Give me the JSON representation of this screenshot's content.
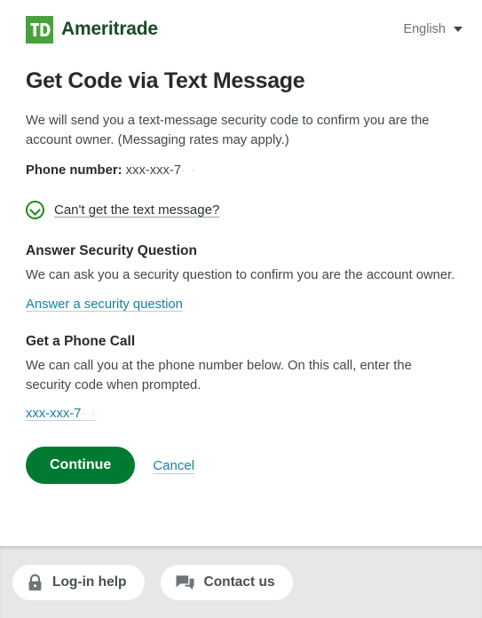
{
  "header": {
    "logo_mark": "td-logo",
    "brand_name": "Ameritrade",
    "language_label": "English",
    "language_caret": "chevron-down-icon"
  },
  "main": {
    "title": "Get Code via Text Message",
    "intro": "We will send you a text-message security code to confirm you are the account owner. (Messaging rates may apply.)",
    "phone_label": "Phone number:",
    "phone_value": "xxx-xxx-7",
    "phone_value_redacted": "· ·",
    "expander": {
      "icon": "circle-chevron-down-icon",
      "label": "Can't get the text message?"
    },
    "sections": [
      {
        "title": "Answer Security Question",
        "body": "We can ask you a security question to confirm you are the account owner.",
        "link": "Answer a security question"
      },
      {
        "title": "Get a Phone Call",
        "body": "We can call you at the phone number below. On this call, enter the security code when prompted.",
        "link": "xxx-xxx-7",
        "link_redacted": "· ·"
      }
    ],
    "continue_label": "Continue",
    "cancel_label": "Cancel"
  },
  "footer": {
    "chips": [
      {
        "icon": "lock-icon",
        "label": "Log-in help"
      },
      {
        "icon": "chat-icon",
        "label": "Contact us"
      }
    ]
  },
  "colors": {
    "logo_green": "#4aa03f",
    "brand_green": "#1a4a26",
    "primary_green": "#007a33",
    "accent_link": "#1a7fa0",
    "icon_green": "#1a8a1a",
    "footer_bg": "#e6e7e8"
  }
}
